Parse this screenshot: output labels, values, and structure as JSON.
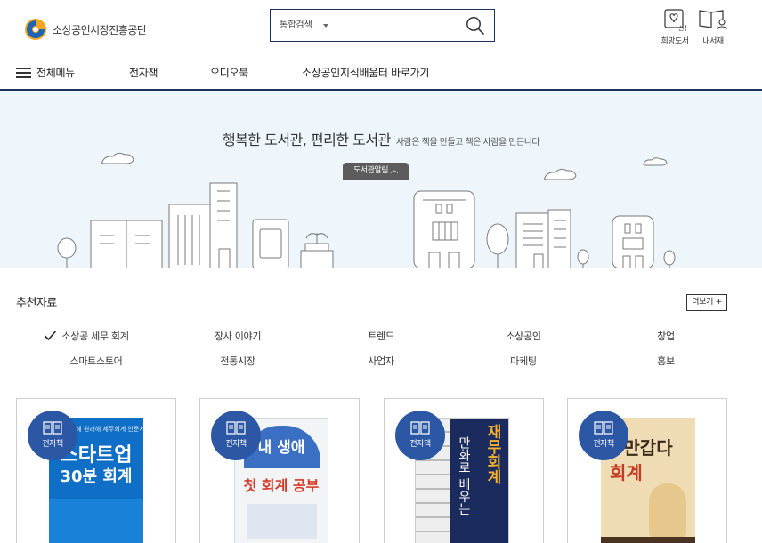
{
  "header": {
    "logo_name": "소상공인시장진흥공단",
    "search": {
      "select_label": "통합검색",
      "placeholder": ""
    },
    "utils": [
      {
        "label": "희망도서",
        "icon": "wish-book-icon",
        "tag": "신청"
      },
      {
        "label": "내서재",
        "icon": "my-library-icon"
      }
    ]
  },
  "nav": {
    "all_menu": "전체메뉴",
    "items": [
      "전자책",
      "오디오북",
      "소상공인지식배움터 바로가기"
    ]
  },
  "banner": {
    "title": "행복한 도서관, 편리한 도서관",
    "subtitle": "사람은 책을 만들고 책은 사람을 만든니다",
    "intro_tab": "도서관알림"
  },
  "recommend": {
    "title": "추천자료",
    "more_label": "더보기 +",
    "categories_row1": [
      "소상공 세무 회계",
      "장사 이야기",
      "트렌드",
      "소상공인",
      "창업"
    ],
    "categories_row2": [
      "스마트스토어",
      "전통시장",
      "사업자",
      "마케팅",
      "홍보"
    ],
    "active_category": 0
  },
  "books": [
    {
      "badge": "전자책",
      "cover_title_line1": "스타트업",
      "cover_title_line2": "30분 회계",
      "cover_top": "잘 아는 이해 원래해 세무회계 인문서"
    },
    {
      "badge": "전자책",
      "cover_title_line1": "내 생애",
      "cover_title_line2": "첫 회계 공부",
      "cover_top": ""
    },
    {
      "badge": "전자책",
      "cover_title_line1": "재무회계",
      "cover_title_line2": "만화로 배우는",
      "cover_top": ""
    },
    {
      "badge": "전자책",
      "cover_title_line1": "만갑다",
      "cover_title_line2": "회계",
      "cover_top": ""
    }
  ],
  "colors": {
    "navy": "#1c2f5a",
    "badge": "#2c57a4",
    "banner_bg": "#eef6fc",
    "logo_orange": "#f5a623",
    "logo_blue": "#1d64b4"
  }
}
